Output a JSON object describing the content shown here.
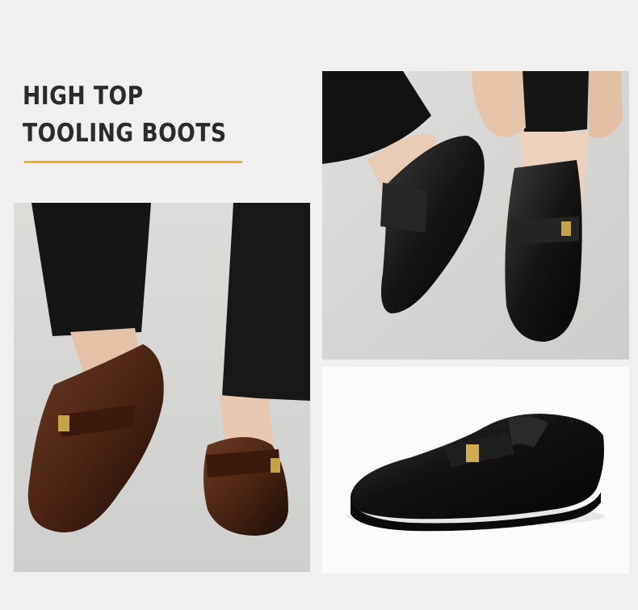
{
  "headline": {
    "line1": "HIGH TOP",
    "line2": "TOOLING BOOTS"
  },
  "colors": {
    "accent": "#f3b21b",
    "background": "#f1f0ef",
    "text": "#2b2b2b"
  },
  "photos": [
    {
      "subject": "brown leather loafers worn with black trousers"
    },
    {
      "subject": "black leather loafers being put on"
    },
    {
      "subject": "single black leather loafer on white"
    }
  ]
}
